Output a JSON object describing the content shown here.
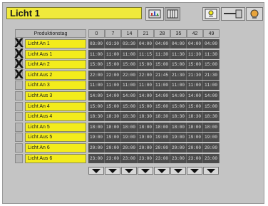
{
  "title": "Licht 1",
  "table": {
    "header_label": "Produktionstag",
    "columns": [
      "0",
      "7",
      "14",
      "21",
      "28",
      "35",
      "42",
      "49"
    ],
    "rows": [
      {
        "label": "Licht An 1",
        "checked": true,
        "values": [
          "03:00",
          "03:30",
          "03:30",
          "04:00",
          "04:00",
          "04:00",
          "04:00",
          "04:00"
        ]
      },
      {
        "label": "Licht Aus 1",
        "checked": true,
        "values": [
          "11:00",
          "11:00",
          "11:00",
          "11:15",
          "11:30",
          "11:30",
          "11:30",
          "11:30"
        ]
      },
      {
        "label": "Licht An 2",
        "checked": true,
        "values": [
          "15:00",
          "15:00",
          "15:00",
          "15:00",
          "15:00",
          "15:00",
          "15:00",
          "15:00"
        ]
      },
      {
        "label": "Licht Aus 2",
        "checked": true,
        "values": [
          "22:00",
          "22:00",
          "22:00",
          "22:00",
          "21:45",
          "21:30",
          "21:30",
          "21:30"
        ]
      },
      {
        "label": "Licht An 3",
        "checked": false,
        "values": [
          "11:00",
          "11:00",
          "11:00",
          "11:00",
          "11:00",
          "11:00",
          "11:00",
          "11:00"
        ]
      },
      {
        "label": "Licht Aus 3",
        "checked": false,
        "values": [
          "14:00",
          "14:00",
          "14:00",
          "14:00",
          "14:00",
          "14:00",
          "14:00",
          "14:00"
        ]
      },
      {
        "label": "Licht An 4",
        "checked": false,
        "values": [
          "15:00",
          "15:00",
          "15:00",
          "15:00",
          "15:00",
          "15:00",
          "15:00",
          "15:00"
        ]
      },
      {
        "label": "Licht Aus 4",
        "checked": false,
        "values": [
          "18:30",
          "18:30",
          "18:30",
          "18:30",
          "18:30",
          "18:30",
          "18:30",
          "18:30"
        ]
      },
      {
        "label": "Licht An 5",
        "checked": false,
        "values": [
          "18:00",
          "18:00",
          "18:00",
          "18:00",
          "18:00",
          "18:00",
          "18:00",
          "18:00"
        ]
      },
      {
        "label": "Licht Aus 5",
        "checked": false,
        "values": [
          "19:00",
          "19:00",
          "19:00",
          "19:00",
          "19:00",
          "19:00",
          "19:00",
          "19:00"
        ]
      },
      {
        "label": "Licht An 6",
        "checked": false,
        "values": [
          "20:00",
          "20:00",
          "20:00",
          "20:00",
          "20:00",
          "20:00",
          "20:00",
          "20:00"
        ]
      },
      {
        "label": "Licht Aus 6",
        "checked": false,
        "values": [
          "23:00",
          "23:00",
          "23:00",
          "23:00",
          "23:00",
          "23:00",
          "23:00",
          "23:00"
        ]
      }
    ]
  },
  "toolbar": {
    "icons": [
      "chart-view-icon",
      "table-view-icon",
      "switch-lamp-icon",
      "hand-control-icon",
      "lamp-icon"
    ]
  },
  "colors": {
    "label_yellow": "#f3ec1c",
    "cell_dark": "#4b4b4b",
    "panel_gray": "#c4c4c4"
  }
}
